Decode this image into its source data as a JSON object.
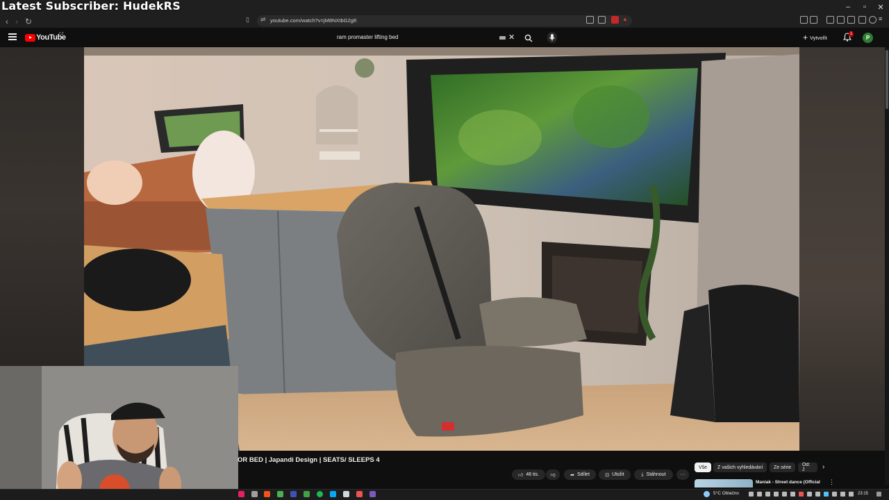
{
  "stream_overlay": {
    "title": "Latest Subscriber: HudekRS"
  },
  "browser": {
    "url": "youtube.com/watch?v=jM8NXtbG2gE",
    "window_controls": [
      "–",
      "▫",
      "✕"
    ]
  },
  "youtube_header": {
    "logo_text": "YouTube",
    "country_code": "CZ",
    "search_query": "ram promaster lifting bed",
    "create_label": "Vytvořit",
    "notification_count": "1",
    "avatar_initial": "P"
  },
  "video": {
    "title": "OR BED | Japandi Design | SEATS/ SLEEPS 4",
    "actions": {
      "like_count": "46 tis.",
      "share_label": "Sdílet",
      "save_label": "Uložit",
      "download_label": "Stáhnout",
      "more_label": "···"
    }
  },
  "recommendations": {
    "chips": [
      {
        "label": "Vše",
        "active": true
      },
      {
        "label": "Z vašich vyhledávání",
        "active": false
      },
      {
        "label": "Ze série",
        "active": false
      },
      {
        "label": "Od: J",
        "active": false
      }
    ],
    "first_item_title": "Maniak - Street dance (Official"
  },
  "taskbar": {
    "weather": "5°C  Oblačno",
    "time": "23:15"
  },
  "colors": {
    "youtube_red": "#ff0000",
    "background": "#0f0f0f",
    "chip_bg": "#272727",
    "avatar_green": "#2e7d32"
  }
}
